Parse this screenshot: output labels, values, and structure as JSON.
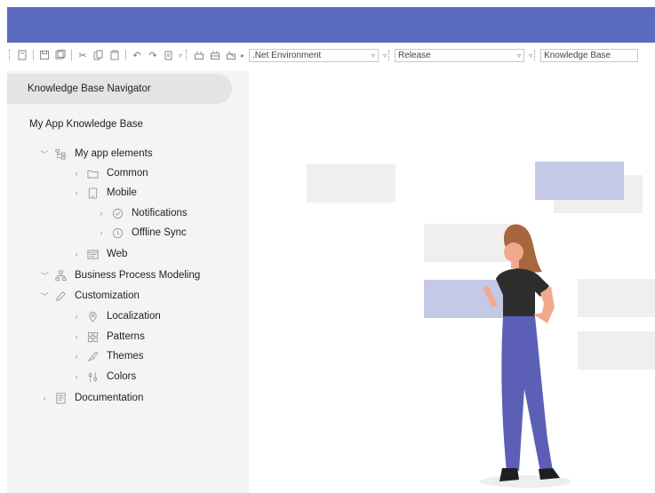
{
  "toolbar": {
    "environment": ".Net Environment",
    "configuration": "Release",
    "kb": "Knowledge Base"
  },
  "navigator": {
    "header": "Knowledge Base Navigator",
    "kb_title": "My App Knowledge Base"
  },
  "tree": {
    "app_elements": {
      "label": "My app elements",
      "icon": "hierarchy-icon"
    },
    "common": {
      "label": "Common",
      "icon": "folder-icon"
    },
    "mobile": {
      "label": "Mobile",
      "icon": "mobile-icon"
    },
    "notifications": {
      "label": "Notifications",
      "icon": "check-circle-icon"
    },
    "offline_sync": {
      "label": "Offline Sync",
      "icon": "history-icon"
    },
    "web": {
      "label": "Web",
      "icon": "web-page-icon"
    },
    "bpm": {
      "label": "Business Process Modeling",
      "icon": "org-chart-icon"
    },
    "customization": {
      "label": "Customization",
      "icon": "pencil-icon"
    },
    "localization": {
      "label": "Localization",
      "icon": "location-pin-icon"
    },
    "patterns": {
      "label": "Patterns",
      "icon": "grid-icon"
    },
    "themes": {
      "label": "Themes",
      "icon": "brush-icon"
    },
    "colors": {
      "label": "Colors",
      "icon": "color-sliders-icon"
    },
    "documentation": {
      "label": "Documentation",
      "icon": "document-icon"
    }
  },
  "colors": {
    "titlebar": "#5b6bc0",
    "accent_light": "#c5c9e8",
    "placeholder_grey": "#efefef",
    "figure_pants": "#5b5fb5",
    "figure_hair": "#a8663f"
  }
}
